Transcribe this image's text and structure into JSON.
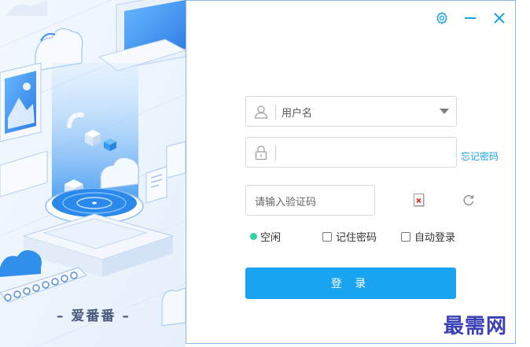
{
  "window": {
    "controls": {
      "settings_icon": "gear-icon",
      "minimize_icon": "minus-icon",
      "close_icon": "close-icon"
    },
    "accent_color": "#1aa3f0"
  },
  "illustration": {
    "brand": "– 爱番番 –"
  },
  "login": {
    "username_placeholder": "用户名",
    "password_value": "",
    "forgot_password": "忘记密码",
    "captcha_placeholder": "请输入验证码",
    "status_label": "空闲",
    "status_color": "#2bd4a0",
    "remember_password": "记住密码",
    "auto_login": "自动登录",
    "login_button": "登 录"
  },
  "watermark": "最需网"
}
